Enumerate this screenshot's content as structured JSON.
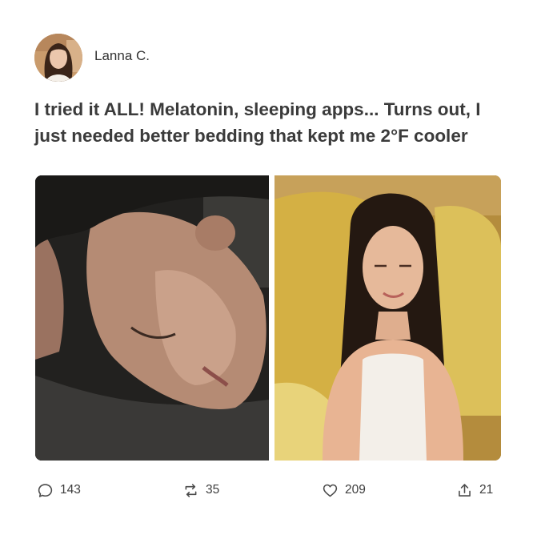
{
  "post": {
    "author_name": "Lanna C.",
    "text": "I tried it ALL! Melatonin, sleeping apps... Turns out, I just needed better bedding that kept me 2°F cooler"
  },
  "actions": {
    "comments": {
      "icon": "comment-icon",
      "count": "143"
    },
    "reposts": {
      "icon": "repost-icon",
      "count": "35"
    },
    "likes": {
      "icon": "heart-icon",
      "count": "209"
    },
    "shares": {
      "icon": "share-icon",
      "count": "21"
    }
  },
  "colors": {
    "text": "#3b3b3b",
    "icon": "#4a4a4a",
    "background": "#ffffff"
  }
}
